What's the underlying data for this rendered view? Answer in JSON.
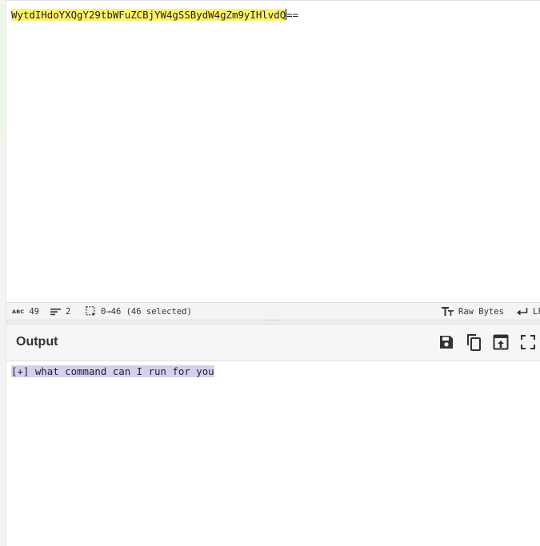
{
  "input": {
    "highlighted_text": "WytdIHdoYXQgY29tbWFuZCBjYW4gSSBydW4gZm9yIHlvdQ",
    "trailing_text": "=="
  },
  "status_bar": {
    "length_icon_label": "ABC",
    "length_value": "49",
    "lines_value": "2",
    "selection_value": "0→46 (46 selected)",
    "encoding_label": "Raw Bytes",
    "eol_label": "LF"
  },
  "output": {
    "title": "Output",
    "text": "[+] what command can I run for you",
    "buttons": [
      "save-icon",
      "copy-icon",
      "replace-input-icon",
      "maximize-icon"
    ]
  },
  "colors": {
    "input_highlight": "#fff36b",
    "output_highlight": "#d6d0f0"
  }
}
